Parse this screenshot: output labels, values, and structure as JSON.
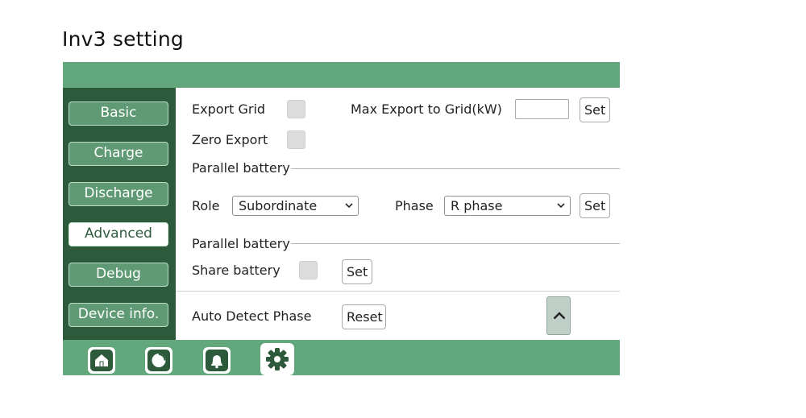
{
  "page": {
    "title": "Inv3 setting"
  },
  "sidebar": {
    "items": [
      {
        "label": "Basic",
        "active": false
      },
      {
        "label": "Charge",
        "active": false
      },
      {
        "label": "Discharge",
        "active": false
      },
      {
        "label": "Advanced",
        "active": true
      },
      {
        "label": "Debug",
        "active": false
      },
      {
        "label": "Device info.",
        "active": false
      }
    ]
  },
  "export": {
    "export_grid_label": "Export Grid",
    "max_export_label": "Max Export to Grid(kW)",
    "max_export_value": "",
    "set_label": "Set",
    "zero_export_label": "Zero Export"
  },
  "parallel1": {
    "legend": "Parallel battery",
    "role_label": "Role",
    "role_value": "Subordinate",
    "phase_label": "Phase",
    "phase_value": "R phase",
    "set_label": "Set"
  },
  "parallel2": {
    "legend": "Parallel battery",
    "share_label": "Share battery",
    "set_label": "Set"
  },
  "auto_detect": {
    "label": "Auto Detect Phase",
    "reset_label": "Reset"
  },
  "bottom_nav": {
    "icons": [
      "home-icon",
      "pie-chart-icon",
      "bell-icon",
      "gear-icon"
    ],
    "active": "gear-icon"
  },
  "colors": {
    "header_green": "#63a77c",
    "sidebar_dark": "#2e5a3c",
    "button_green": "#5f9a74"
  }
}
